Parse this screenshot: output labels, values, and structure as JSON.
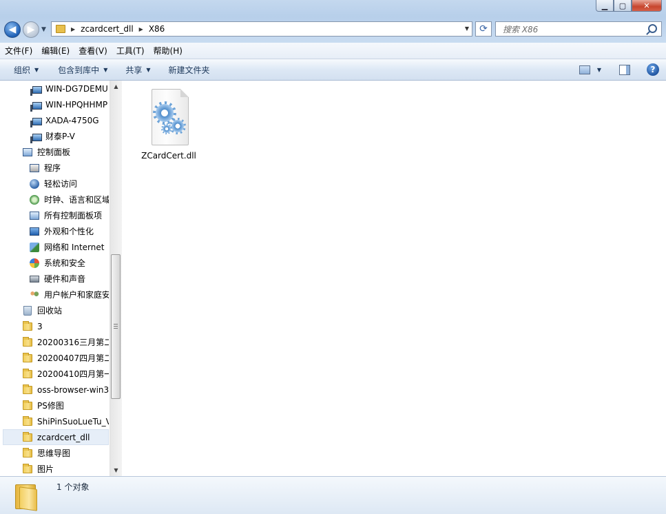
{
  "window": {
    "caption_buttons": {
      "minimize": "▁",
      "maximize": "▢",
      "close": "✕"
    }
  },
  "navigation": {
    "back_icon": "back-arrow-icon",
    "forward_icon": "forward-arrow-icon"
  },
  "address_bar": {
    "crumbs": [
      "zcardcert_dll",
      "X86"
    ]
  },
  "search": {
    "placeholder": "搜索 X86"
  },
  "menubar": {
    "items": [
      "文件(F)",
      "编辑(E)",
      "查看(V)",
      "工具(T)",
      "帮助(H)"
    ]
  },
  "commandbar": {
    "organize": "组织",
    "include_library": "包含到库中",
    "share": "共享",
    "new_folder": "新建文件夹"
  },
  "nav_tree": {
    "items": [
      {
        "label": "WIN-DG7DEMU",
        "icon": "computer-icon"
      },
      {
        "label": "WIN-HPQHHMP",
        "icon": "computer-icon"
      },
      {
        "label": "XADA-4750G",
        "icon": "computer-icon"
      },
      {
        "label": "财泰P-V",
        "icon": "computer-icon"
      },
      {
        "label": "控制面板",
        "icon": "control-panel-icon"
      },
      {
        "label": "程序",
        "icon": "programs-icon"
      },
      {
        "label": "轻松访问",
        "icon": "ease-of-access-icon"
      },
      {
        "label": "时钟、语言和区域",
        "icon": "clock-language-icon"
      },
      {
        "label": "所有控制面板项",
        "icon": "control-panel-items-icon"
      },
      {
        "label": "外观和个性化",
        "icon": "appearance-icon"
      },
      {
        "label": "网络和 Internet",
        "icon": "network-icon"
      },
      {
        "label": "系统和安全",
        "icon": "system-security-icon"
      },
      {
        "label": "硬件和声音",
        "icon": "hardware-sound-icon"
      },
      {
        "label": "用户帐户和家庭安全",
        "icon": "user-accounts-icon"
      },
      {
        "label": "回收站",
        "icon": "recycle-bin-icon"
      },
      {
        "label": "3",
        "icon": "folder-icon"
      },
      {
        "label": "20200316三月第二",
        "icon": "folder-icon"
      },
      {
        "label": "20200407四月第二",
        "icon": "folder-icon"
      },
      {
        "label": "20200410四月第一",
        "icon": "folder-icon"
      },
      {
        "label": "oss-browser-win3",
        "icon": "folder-icon"
      },
      {
        "label": "PS修图",
        "icon": "folder-icon"
      },
      {
        "label": "ShiPinSuoLueTu_V",
        "icon": "folder-icon"
      },
      {
        "label": "zcardcert_dll",
        "icon": "folder-icon",
        "selected": true
      },
      {
        "label": "思维导图",
        "icon": "folder-icon"
      },
      {
        "label": "图片",
        "icon": "folder-icon"
      }
    ]
  },
  "files": [
    {
      "name": "ZCardCert.dll",
      "icon": "dll-gears-icon"
    }
  ],
  "statusbar": {
    "text": "1 个对象"
  }
}
